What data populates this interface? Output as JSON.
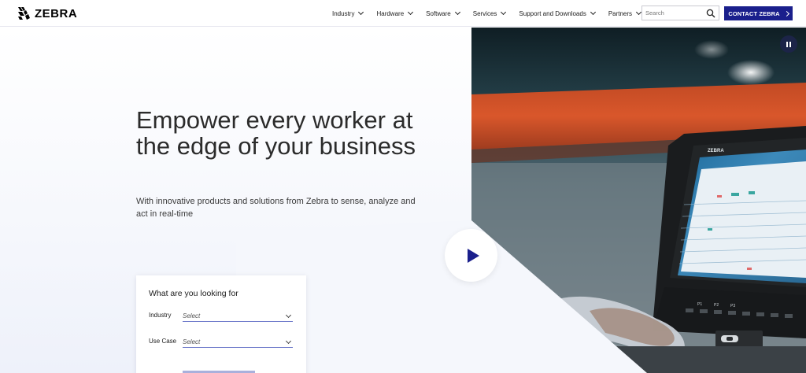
{
  "header": {
    "logo_text": "ZEBRA",
    "nav": [
      {
        "label": "Industry"
      },
      {
        "label": "Hardware"
      },
      {
        "label": "Software"
      },
      {
        "label": "Services"
      },
      {
        "label": "Support and Downloads"
      },
      {
        "label": "Partners"
      }
    ],
    "search_placeholder": "Search",
    "contact_label": "CONTACT ZEBRA"
  },
  "hero": {
    "headline": "Empower every worker at the edge of your business",
    "subline": "With innovative products and solutions from Zebra to sense, analyze and act in real-time"
  },
  "finder": {
    "title": "What are you looking for",
    "fields": [
      {
        "label": "Industry",
        "value": "Select"
      },
      {
        "label": "Use Case",
        "value": "Select"
      }
    ]
  },
  "colors": {
    "brand": "#1a1f8c",
    "pause_bg": "#1c2448"
  },
  "icons": {
    "search": "search-icon",
    "play": "play-icon",
    "pause": "pause-icon"
  }
}
